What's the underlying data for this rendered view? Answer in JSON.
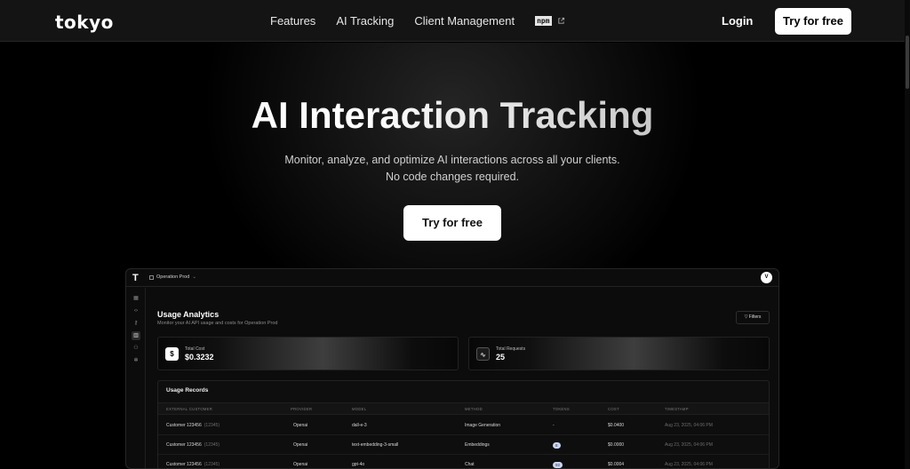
{
  "nav": {
    "logo": "tokyo",
    "links": [
      "Features",
      "AI Tracking",
      "Client Management"
    ],
    "npm_label": "npm",
    "login": "Login",
    "cta": "Try for free"
  },
  "hero": {
    "title": "AI Interaction Tracking",
    "subtitle_line1": "Monitor, analyze, and optimize AI interactions across all your clients.",
    "subtitle_line2": "No code changes required.",
    "cta": "Try for free"
  },
  "app": {
    "logo": "T",
    "project": "Operation Prod",
    "avatar": "V",
    "sidebar_icons": [
      "grid-icon",
      "code-icon",
      "key-icon",
      "chart-icon",
      "users-icon",
      "settings-icon"
    ],
    "title": "Usage Analytics",
    "subtitle": "Monitor your AI API usage and costs for Operation Prod",
    "filters": "Filters",
    "stats": [
      {
        "label": "Total Cost",
        "value": "$0.3232",
        "icon": "dollar-icon"
      },
      {
        "label": "Total Requests",
        "value": "25",
        "icon": "activity-icon"
      }
    ],
    "records": {
      "title": "Usage Records",
      "columns": [
        "EXTERNAL CUSTOMER",
        "PROVIDER",
        "MODEL",
        "METHOD",
        "TOKENS",
        "COST",
        "TIMESTAMP"
      ],
      "rows": [
        {
          "customer": "Customer 123456",
          "id": "(12345)",
          "provider": "Openai",
          "model": "dall-e-3",
          "method": "Image Generation",
          "tokens": "-",
          "cost": "$0.0400",
          "timestamp": "Aug 23, 2025, 04:06 PM"
        },
        {
          "customer": "Customer 123456",
          "id": "(12345)",
          "provider": "Openai",
          "model": "text-embedding-3-small",
          "method": "Embeddings",
          "tokens": "8",
          "cost": "$0.0000",
          "timestamp": "Aug 23, 2025, 04:06 PM"
        },
        {
          "customer": "Customer 123456",
          "id": "(12345)",
          "provider": "Openai",
          "model": "gpt-4o",
          "method": "Chat",
          "tokens": "92",
          "cost": "$0.0004",
          "timestamp": "Aug 23, 2025, 04:06 PM"
        }
      ]
    }
  }
}
